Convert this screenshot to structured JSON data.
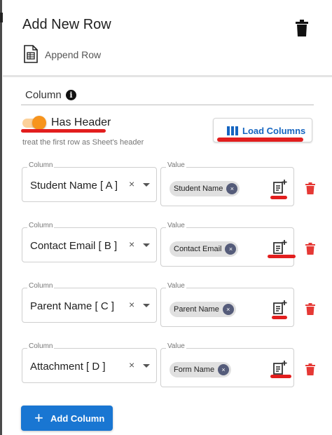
{
  "header": {
    "title": "Add New Row",
    "subtitle": "Append Row",
    "subtitle_icon": "sheet-icon",
    "delete_icon": "trash-icon"
  },
  "column_section": {
    "label": "Column",
    "info_icon": "info-icon",
    "info_glyph": "i"
  },
  "has_header": {
    "label": "Has Header",
    "enabled": true,
    "helper": "treat the first row as Sheet's header"
  },
  "load_columns": {
    "label": "Load Columns",
    "icon": "columns-icon"
  },
  "field_labels": {
    "column": "Column",
    "value": "Value"
  },
  "rows": [
    {
      "column": "Student Name [ A ]",
      "value_chip": "Student Name"
    },
    {
      "column": "Contact Email [ B ]",
      "value_chip": "Contact Email"
    },
    {
      "column": "Parent Name [ C ]",
      "value_chip": "Parent Name"
    },
    {
      "column": "Attachment [ D ]",
      "value_chip": "Form Name"
    }
  ],
  "row_controls": {
    "clear_glyph": "×",
    "chip_remove_glyph": "×",
    "paste_icon": "paste-plus-icon",
    "delete_icon": "trash-icon"
  },
  "add_column": {
    "label": "Add Column",
    "icon_glyph": "+"
  },
  "colors": {
    "accent_blue": "#1976d2",
    "toggle_orange": "#f7941d",
    "annotation_red": "#e21e1e",
    "delete_red": "#e53935"
  }
}
